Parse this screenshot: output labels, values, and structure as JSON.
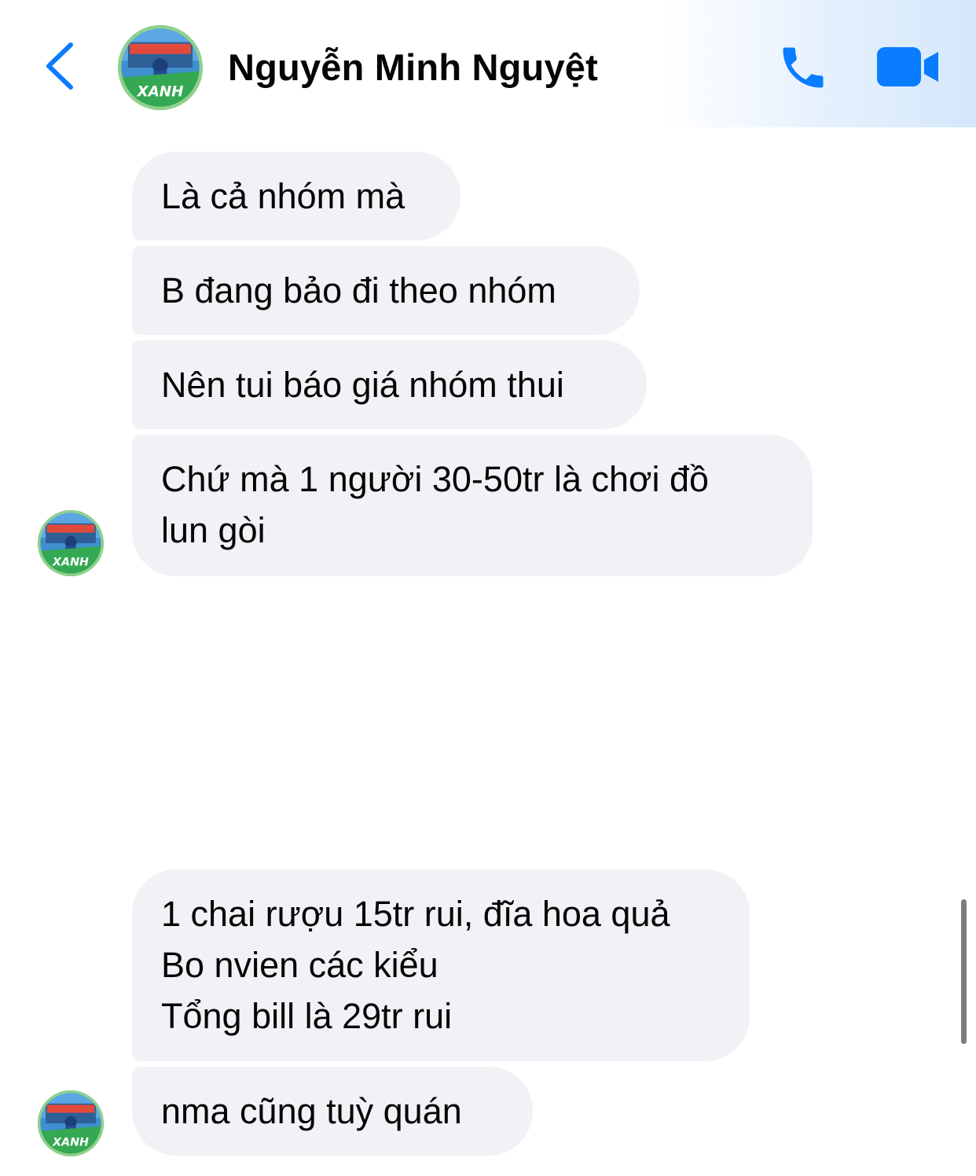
{
  "header": {
    "back_icon": "chevron-left-icon",
    "contact_name": "Nguyễn Minh Nguyệt",
    "call_icon": "phone-icon",
    "video_icon": "video-camera-icon",
    "accent_color": "#0a7cff"
  },
  "avatar": {
    "logo_word": "XANH"
  },
  "messages": [
    {
      "text": "Là cả nhóm mà"
    },
    {
      "text": "B đang bảo đi theo nhóm"
    },
    {
      "text": "Nên tui báo giá nhóm thui"
    },
    {
      "text": "Chứ mà 1 người 30-50tr là chơi đồ\nlun gòi"
    },
    {
      "text": "1 chai rượu 15tr rui, đĩa hoa quả\nBo nvien các kiểu\nTổng bill là 29tr rui"
    },
    {
      "text": "nma cũng tuỳ quán"
    }
  ],
  "colors": {
    "bubble_bg": "#f0f2f5",
    "text": "#050505"
  }
}
